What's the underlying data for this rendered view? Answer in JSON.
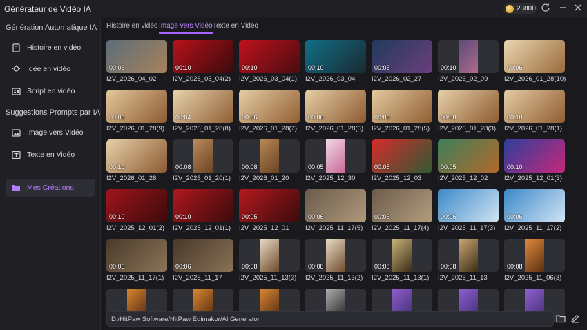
{
  "app": {
    "title": "Générateur de Vidéo IA",
    "credits": "23800"
  },
  "sidebar": {
    "section1": "Génération Automatique IA",
    "section2": "Suggestions Prompts par IA",
    "items": [
      {
        "label": "Histoire en vidéo",
        "icon": "book-icon"
      },
      {
        "label": "Idée en vidéo",
        "icon": "lightbulb-icon"
      },
      {
        "label": "Script en vidéo",
        "icon": "script-icon"
      },
      {
        "label": "Image vers Vidéo",
        "icon": "image-icon"
      },
      {
        "label": "Texte en Vidéo",
        "icon": "text-icon"
      },
      {
        "label": "Mes Créations",
        "icon": "folder-icon"
      }
    ]
  },
  "tabs": [
    "Histoire en vidéo",
    "Image vers Vidéo",
    "Texte en Vidéo"
  ],
  "active_tab": "Image vers Vidéo",
  "items": [
    {
      "name": "I2V_2026_04_02",
      "dur": "00:05",
      "c1": "#5c6d78",
      "c2": "#a7825c"
    },
    {
      "name": "I2V_2026_03_04(2)",
      "dur": "00:10",
      "c1": "#b8121a",
      "c2": "#3a0a0c"
    },
    {
      "name": "I2V_2026_03_04(1)",
      "dur": "00:10",
      "c1": "#c1121c",
      "c2": "#4a0c10"
    },
    {
      "name": "I2V_2026_03_04",
      "dur": "00:10",
      "c1": "#0f6f86",
      "c2": "#1b2a33"
    },
    {
      "name": "I2V_2026_02_27",
      "dur": "00:05",
      "c1": "#203a5c",
      "c2": "#6b3f7c"
    },
    {
      "name": "I2V_2026_02_09",
      "dur": "00:10",
      "c1": "#5b4b7a",
      "c2": "#b06a8a"
    },
    {
      "name": "I2V_2026_01_28(10)",
      "dur": "00:06",
      "c1": "#ead6b0",
      "c2": "#9a6a3c"
    },
    {
      "name": "I2V_2026_01_28(9)",
      "dur": "00:06",
      "c1": "#e2c79a",
      "c2": "#8e5b33"
    },
    {
      "name": "I2V_2026_01_28(8)",
      "dur": "00:04",
      "c1": "#e8d3ad",
      "c2": "#8f5e34"
    },
    {
      "name": "I2V_2026_01_28(7)",
      "dur": "00:06",
      "c1": "#e5cea4",
      "c2": "#935f34"
    },
    {
      "name": "I2V_2026_01_28(6)",
      "dur": "00:06",
      "c1": "#e6cfa6",
      "c2": "#8d5a31"
    },
    {
      "name": "I2V_2026_01_28(5)",
      "dur": "00:06",
      "c1": "#e3cba0",
      "c2": "#915d33"
    },
    {
      "name": "I2V_2026_01_28(3)",
      "dur": "00:08",
      "c1": "#e7d0a8",
      "c2": "#8e5c32"
    },
    {
      "name": "I2V_2026_01_28(1)",
      "dur": "00:10",
      "c1": "#e4cca3",
      "c2": "#905c33"
    },
    {
      "name": "I2V_2026_01_28",
      "dur": "00:10",
      "c1": "#e6d0a9",
      "c2": "#8c5a31"
    },
    {
      "name": "I2V_2026_01_20(1)",
      "dur": "00:08",
      "c1": "#b98a5c",
      "c2": "#6b4424"
    },
    {
      "name": "I2V_2026_01_20",
      "dur": "00:08",
      "c1": "#b88958",
      "c2": "#6a4323"
    },
    {
      "name": "I2V_2025_12_30",
      "dur": "00:05",
      "c1": "#f0d7e6",
      "c2": "#c96a97"
    },
    {
      "name": "I2V_2025_12_03",
      "dur": "00:05",
      "c1": "#d82b2b",
      "c2": "#2f5a34"
    },
    {
      "name": "I2V_2025_12_02",
      "dur": "00:05",
      "c1": "#3f7f5a",
      "c2": "#b06a2c"
    },
    {
      "name": "I2V_2025_12_01(3)",
      "dur": "00:10",
      "c1": "#2e3f9c",
      "c2": "#c4287a"
    },
    {
      "name": "I2V_2025_12_01(2)",
      "dur": "00:10",
      "c1": "#a0151a",
      "c2": "#3c0a0c"
    },
    {
      "name": "I2V_2025_12_01(1)",
      "dur": "00:10",
      "c1": "#b0181d",
      "c2": "#3a0b0d"
    },
    {
      "name": "I2V_2025_12_01",
      "dur": "00:05",
      "c1": "#b3191d",
      "c2": "#3b0b0d"
    },
    {
      "name": "I2V_2025_11_17(5)",
      "dur": "00:06",
      "c1": "#6a5a4a",
      "c2": "#b09a7c"
    },
    {
      "name": "I2V_2025_11_17(4)",
      "dur": "00:06",
      "c1": "#6c5b4b",
      "c2": "#b39d7e"
    },
    {
      "name": "I2V_2025_11_17(3)",
      "dur": "00:06",
      "c1": "#3d8ac9",
      "c2": "#cfe3f2"
    },
    {
      "name": "I2V_2025_11_17(2)",
      "dur": "00:06",
      "c1": "#3a88c8",
      "c2": "#d1e4f3"
    },
    {
      "name": "I2V_2025_11_17(1)",
      "dur": "00:06",
      "c1": "#4a3a2a",
      "c2": "#8a7458"
    },
    {
      "name": "I2V_2025_11_17",
      "dur": "00:06",
      "c1": "#483829",
      "c2": "#887256"
    },
    {
      "name": "I2V_2025_11_13(3)",
      "dur": "00:08",
      "c1": "#e9dcc7",
      "c2": "#6e4a2b"
    },
    {
      "name": "I2V_2025_11_13(2)",
      "dur": "00:08",
      "c1": "#eadcc8",
      "c2": "#6f4b2c"
    },
    {
      "name": "I2V_2025_11_13(1)",
      "dur": "00:08",
      "c1": "#c9b37a",
      "c2": "#3a2d16"
    },
    {
      "name": "I2V_2025_11_13",
      "dur": "00:08",
      "c1": "#caa874",
      "c2": "#3b2c15"
    },
    {
      "name": "I2V_2025_11_06(3)",
      "dur": "00:08",
      "c1": "#e08a3c",
      "c2": "#5a2f12"
    },
    {
      "name": "",
      "dur": "",
      "c1": "#d9862f",
      "c2": "#4a2210"
    },
    {
      "name": "",
      "dur": "",
      "c1": "#da8830",
      "c2": "#4b2311"
    },
    {
      "name": "",
      "dur": "",
      "c1": "#db8931",
      "c2": "#4c2412"
    },
    {
      "name": "",
      "dur": "",
      "c1": "#b0b0b0",
      "c2": "#1a1a1a"
    },
    {
      "name": "",
      "dur": "",
      "c1": "#8f5fcf",
      "c2": "#3a2a6a"
    },
    {
      "name": "",
      "dur": "",
      "c1": "#9060d0",
      "c2": "#3b2b6b"
    },
    {
      "name": "",
      "dur": "",
      "c1": "#9161d1",
      "c2": "#3c2c6c"
    }
  ],
  "output_path": "D:/HitPaw Software/HitPaw Edimakor/AI Generator",
  "accent": "#a860ff"
}
